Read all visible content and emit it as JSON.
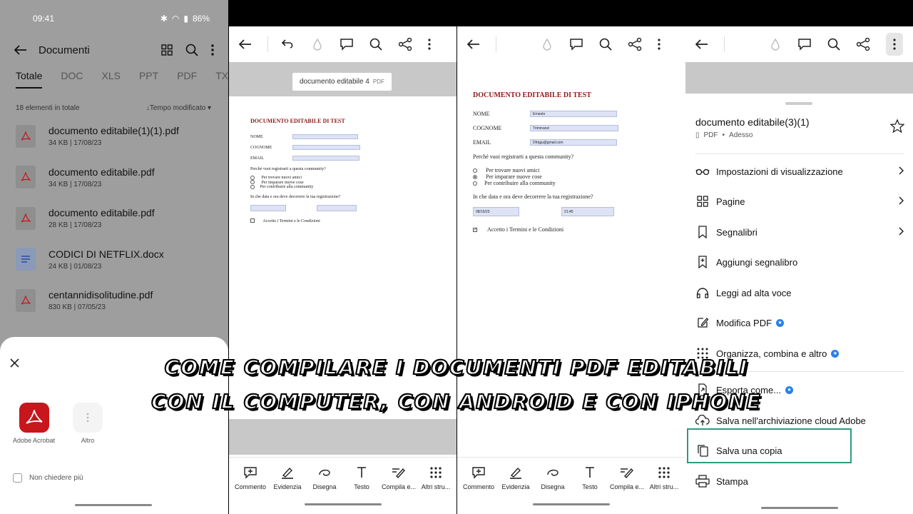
{
  "panel1": {
    "status": {
      "time": "09:41",
      "battery": "86%"
    },
    "header": {
      "title": "Documenti"
    },
    "tabs": [
      "Totale",
      "DOC",
      "XLS",
      "PPT",
      "PDF",
      "TXT"
    ],
    "count": "18 elementi in totale",
    "sort": "Tempo modificato",
    "files": [
      {
        "name": "documento editabile(1)(1).pdf",
        "size": "34 KB",
        "date": "17/08/23",
        "type": "pdf"
      },
      {
        "name": "documento editabile.pdf",
        "size": "34 KB",
        "date": "17/08/23",
        "type": "pdf"
      },
      {
        "name": "documento editabile.pdf",
        "size": "28 KB",
        "date": "17/08/23",
        "type": "pdf"
      },
      {
        "name": "CODICI DI NETFLIX.docx",
        "size": "24 KB",
        "date": "01/08/23",
        "type": "doc"
      },
      {
        "name": "centannidisolitudine.pdf",
        "size": "830 KB",
        "date": "07/05/23",
        "type": "pdf"
      }
    ],
    "sheet": {
      "app1": "Adobe Acrobat",
      "app2": "Altro",
      "checkbox": "Non chiedere più"
    }
  },
  "panel2": {
    "docname": "documento editabile 4",
    "doctag": "PDF",
    "form": {
      "title": "DOCUMENTO EDITABILE DI TEST",
      "nome": "NOME",
      "cognome": "COGNOME",
      "email": "EMAIL",
      "question": "Perché vuoi registrarti a questa community?",
      "opt1": "Per trovare nuovi amici",
      "opt2": "Per imparare nuove cose",
      "opt3": "Per contribuire alla community",
      "when": "In che data e ora deve decorrere la tua registrazione?",
      "terms": "Accetto i Termini e le Condizioni"
    }
  },
  "panel3": {
    "form": {
      "title": "DOCUMENTO EDITABILE DI TEST",
      "nome": "NOME",
      "cognome": "COGNOME",
      "email": "EMAIL",
      "nome_val": "Ernesto",
      "cognome_val": "Trimmanzi",
      "email_val": "Dfrtgju@gmail.com",
      "question": "Perché vuoi registrarti a questa community?",
      "opt1": "Per trovare nuovi amici",
      "opt2": "Per imparare nuove cose",
      "opt3": "Per contribuire alla community",
      "when": "In che data e ora deve decorrere la tua registrazione?",
      "date_val": "08/15/23",
      "time_val": "21:45",
      "terms": "Accetto i Termini e le Condizioni"
    }
  },
  "toolbar": {
    "commento": "Commento",
    "evidenzia": "Evidenzia",
    "disegna": "Disegna",
    "testo": "Testo",
    "compila": "Compila e...",
    "altri": "Altri stru..."
  },
  "panel4": {
    "title": "documento editabile(3)(1)",
    "type": "PDF",
    "time": "Adesso",
    "menu": [
      "Impostazioni di visualizzazione",
      "Pagine",
      "Segnalibri",
      "Aggiungi segnalibro",
      "Leggi ad alta voce",
      "Modifica PDF",
      "Organizza, combina e altro",
      "Esporta come...",
      "Salva nell'archiviazione cloud Adobe",
      "Salva una copia",
      "Stampa"
    ]
  },
  "overlay": {
    "line1": "COME COMPILARE I DOCUMENTI PDF EDITABILI",
    "line2": "CON IL COMPUTER, CON ANDROID E CON IPHONE"
  },
  "colors": {
    "acrobat_red": "#c8161d",
    "doc_title": "#8b1a1a",
    "highlight": "#2a9d7f",
    "premium": "#2680eb"
  }
}
